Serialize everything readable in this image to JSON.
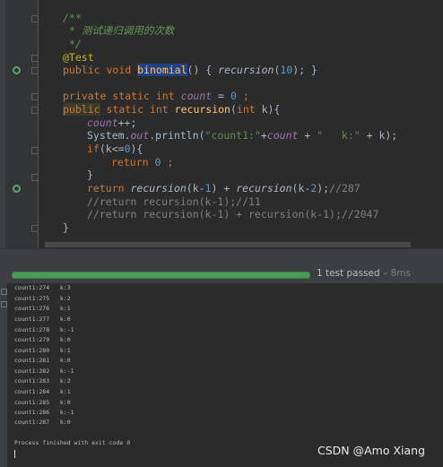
{
  "editor": {
    "lines": {
      "l1": "/**",
      "l2": " * 测试递归调用的次数",
      "l3": " */",
      "l4": "@Test",
      "l5_kw1": "public",
      "l5_kw2": "void",
      "l5_fn": "binomial",
      "l5_rest1": "() { ",
      "l5_call": "recursion",
      "l5_rest2": "(",
      "l5_num": "10",
      "l5_rest3": "); }",
      "l7_kw1": "private static int",
      "l7_fld": "count",
      "l7_rest1": " = ",
      "l7_num": "0",
      "l7_rest2": " ;",
      "l8_kw1": "public",
      "l8_kw2": "static int",
      "l8_fn": "recursion",
      "l8_rest1": "(",
      "l8_kw3": "int",
      "l8_rest2": " k){",
      "l9_fld": "count",
      "l9_rest": "++;",
      "l10_a": "System.",
      "l10_out": "out",
      "l10_b": ".println(",
      "l10_s1": "\"count1:\"",
      "l10_c": "+",
      "l10_fld": "count",
      "l10_d": " + ",
      "l10_s2": "\"   k:\"",
      "l10_e": " + k);",
      "l11_kw": "if",
      "l11_a": "(k<=",
      "l11_num": "0",
      "l11_b": "){",
      "l12_kw": "return",
      "l12_num": "0",
      "l12_rest": " ;",
      "l13": "}",
      "l14_kw": "return",
      "l14_c1": "recursion",
      "l14_a": "(k-",
      "l14_n1": "1",
      "l14_b": ") + ",
      "l14_c2": "recursion",
      "l14_c": "(k-",
      "l14_n2": "2",
      "l14_d": ");",
      "l14_cmt": "//287",
      "l15": "//return recursion(k-1);//11",
      "l16": "//return recursion(k-1) + recursion(k-1);//2047",
      "l17": "}"
    }
  },
  "test_run": {
    "progress_fraction": 1.0,
    "status_text": "1 test passed",
    "duration_text": " – 8ms"
  },
  "console": {
    "lines": [
      "count1:274   k:3",
      "count1:275   k:2",
      "count1:276   k:1",
      "count1:277   k:0",
      "count1:278   k:-1",
      "count1:279   k:0",
      "count1:280   k:1",
      "count1:281   k:0",
      "count1:282   k:-1",
      "count1:283   k:2",
      "count1:284   k:1",
      "count1:285   k:0",
      "count1:286   k:-1",
      "count1:287   k:0"
    ],
    "finish": "Process finished with exit code 0"
  },
  "watermark": "CSDN @Amo Xiang",
  "icons": {
    "run_gutter": "run-test-icon",
    "recursion_gutter": "recursive-call-icon"
  },
  "colors": {
    "background": "#2b2b2b",
    "progress": "#499c54"
  }
}
